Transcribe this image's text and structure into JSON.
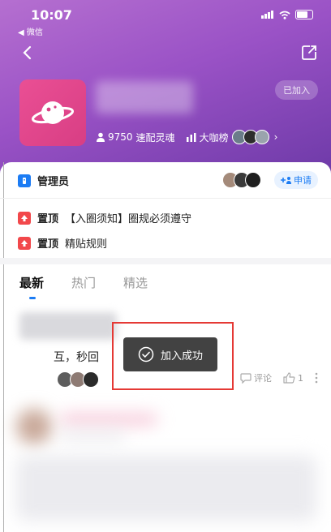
{
  "status_bar": {
    "time": "10:07",
    "back_app": "◀ 微信"
  },
  "circle": {
    "joined_label": "已加入",
    "member_count": "9750",
    "member_label": "速配灵魂",
    "ranking_label": "大咖榜",
    "chevron": "›"
  },
  "admin": {
    "label": "管理员",
    "apply_label": "申请"
  },
  "pinned": [
    {
      "tag": "置顶",
      "text": "【入圈须知】圈规必须遵守"
    },
    {
      "tag": "置顶",
      "text": "精贴规则"
    }
  ],
  "tabs": [
    {
      "label": "最新",
      "active": true
    },
    {
      "label": "热门",
      "active": false
    },
    {
      "label": "精选",
      "active": false
    }
  ],
  "post": {
    "text": "互，秒回",
    "likes_count": "1",
    "comment_label": "评论"
  },
  "toast": {
    "text": "加入成功"
  },
  "colors": {
    "accent": "#1c7cf4",
    "header": "#9a52c6",
    "pin": "#f2484b",
    "highlight": "#e53935"
  }
}
